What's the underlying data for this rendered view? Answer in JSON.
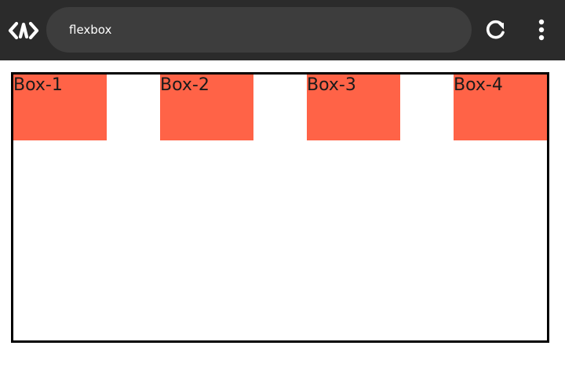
{
  "toolbar": {
    "logo_icon": "code-brackets-logo-icon",
    "address": "flexbox",
    "reload_icon": "reload-icon",
    "menu_icon": "more-vertical-icon"
  },
  "flex_demo": {
    "boxes": [
      {
        "label": "Box-1"
      },
      {
        "label": "Box-2"
      },
      {
        "label": "Box-3"
      },
      {
        "label": "Box-4"
      }
    ],
    "box_color": "#ff6347",
    "border_color": "#000000"
  },
  "colors": {
    "toolbar_background": "#2b2b2b",
    "address_background": "#3d3d3d",
    "toolbar_foreground": "#ffffff"
  }
}
